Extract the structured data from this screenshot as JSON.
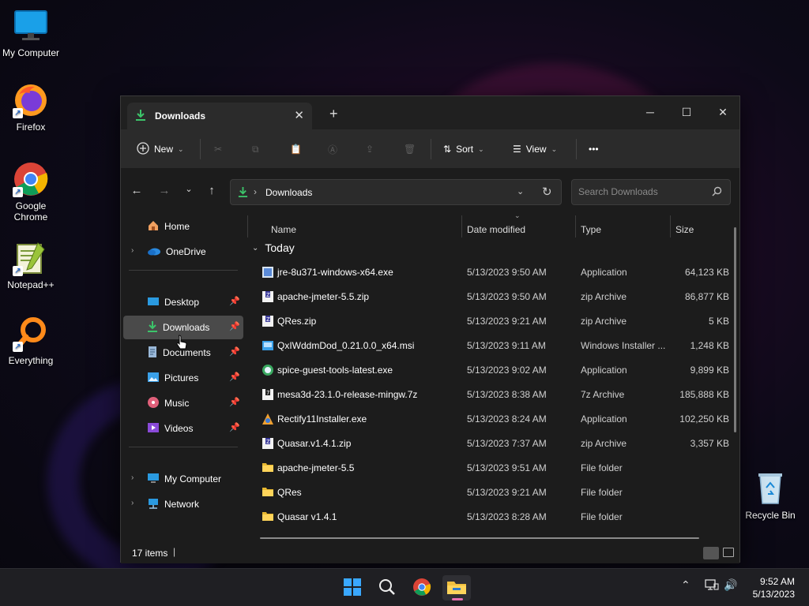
{
  "desktop": {
    "icons": [
      {
        "label": "My Computer"
      },
      {
        "label": "Firefox"
      },
      {
        "label": "Google Chrome"
      },
      {
        "label": "Notepad++"
      },
      {
        "label": "Everything"
      },
      {
        "label": "Recycle Bin"
      }
    ]
  },
  "window": {
    "tab_title": "Downloads",
    "toolbar": {
      "new_label": "New",
      "sort_label": "Sort",
      "view_label": "View",
      "more_label": "•••"
    },
    "address": {
      "path": "Downloads"
    },
    "search": {
      "placeholder": "Search Downloads"
    },
    "sidebar": {
      "items": [
        {
          "label": "Home"
        },
        {
          "label": "OneDrive"
        },
        {
          "label": "Desktop"
        },
        {
          "label": "Downloads"
        },
        {
          "label": "Documents"
        },
        {
          "label": "Pictures"
        },
        {
          "label": "Music"
        },
        {
          "label": "Videos"
        },
        {
          "label": "My Computer"
        },
        {
          "label": "Network"
        }
      ]
    },
    "columns": {
      "name": "Name",
      "date": "Date modified",
      "type": "Type",
      "size": "Size"
    },
    "group": "Today",
    "files": [
      {
        "name": "jre-8u371-windows-x64.exe",
        "date": "5/13/2023 9:50 AM",
        "type": "Application",
        "size": "64,123 KB",
        "icon": "installer-icon"
      },
      {
        "name": "apache-jmeter-5.5.zip",
        "date": "5/13/2023 9:50 AM",
        "type": "zip Archive",
        "size": "86,877 KB",
        "icon": "zip-icon"
      },
      {
        "name": "QRes.zip",
        "date": "5/13/2023 9:21 AM",
        "type": "zip Archive",
        "size": "5 KB",
        "icon": "zip-icon"
      },
      {
        "name": "QxIWddmDod_0.21.0.0_x64.msi",
        "date": "5/13/2023 9:11 AM",
        "type": "Windows Installer ...",
        "size": "1,248 KB",
        "icon": "msi-icon"
      },
      {
        "name": "spice-guest-tools-latest.exe",
        "date": "5/13/2023 9:02 AM",
        "type": "Application",
        "size": "9,899 KB",
        "icon": "setup-icon"
      },
      {
        "name": "mesa3d-23.1.0-release-mingw.7z",
        "date": "5/13/2023 8:38 AM",
        "type": "7z Archive",
        "size": "185,888 KB",
        "icon": "7z-icon"
      },
      {
        "name": "Rectify11Installer.exe",
        "date": "5/13/2023 8:24 AM",
        "type": "Application",
        "size": "102,250 KB",
        "icon": "app-icon"
      },
      {
        "name": "Quasar.v1.4.1.zip",
        "date": "5/13/2023 7:37 AM",
        "type": "zip Archive",
        "size": "3,357 KB",
        "icon": "zip-icon"
      },
      {
        "name": "apache-jmeter-5.5",
        "date": "5/13/2023 9:51 AM",
        "type": "File folder",
        "size": "",
        "icon": "folder-icon"
      },
      {
        "name": "QRes",
        "date": "5/13/2023 9:21 AM",
        "type": "File folder",
        "size": "",
        "icon": "folder-icon"
      },
      {
        "name": "Quasar v1.4.1",
        "date": "5/13/2023 8:28 AM",
        "type": "File folder",
        "size": "",
        "icon": "folder-icon"
      }
    ],
    "status": {
      "item_count": "17 items"
    }
  },
  "taskbar": {
    "time": "9:52 AM",
    "date": "5/13/2023"
  },
  "colors": {
    "accent": "#e66fb0",
    "folder": "#f0c040",
    "download_green": "#3cc46a"
  }
}
